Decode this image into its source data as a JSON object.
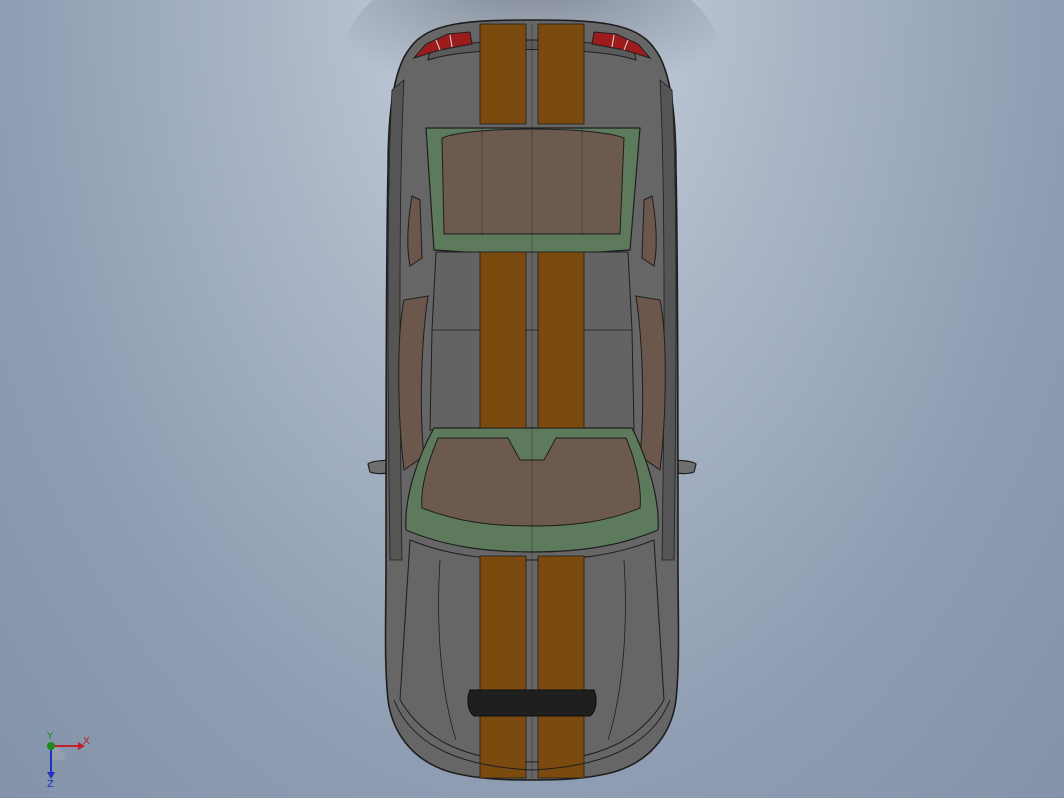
{
  "app": {
    "view_name": "Top",
    "background_colors": [
      "#c9d2de",
      "#8393a9"
    ]
  },
  "model": {
    "part": "sports-car-top-view",
    "colors": {
      "body": "#6b6b6b",
      "body_dark": "#4f4f4f",
      "edge": "#1e1e1e",
      "stripe": "#7a4a10",
      "glass_frame": "#5d7a5d",
      "glass": "#6e5a4e",
      "tail_light": "#a01818",
      "grille": "#202020"
    }
  },
  "triad": {
    "x_label": "X",
    "y_label": "Y",
    "z_label": "Z",
    "x_color": "#c0202a",
    "y_color": "#1a8a1a",
    "z_color": "#2030c0"
  }
}
